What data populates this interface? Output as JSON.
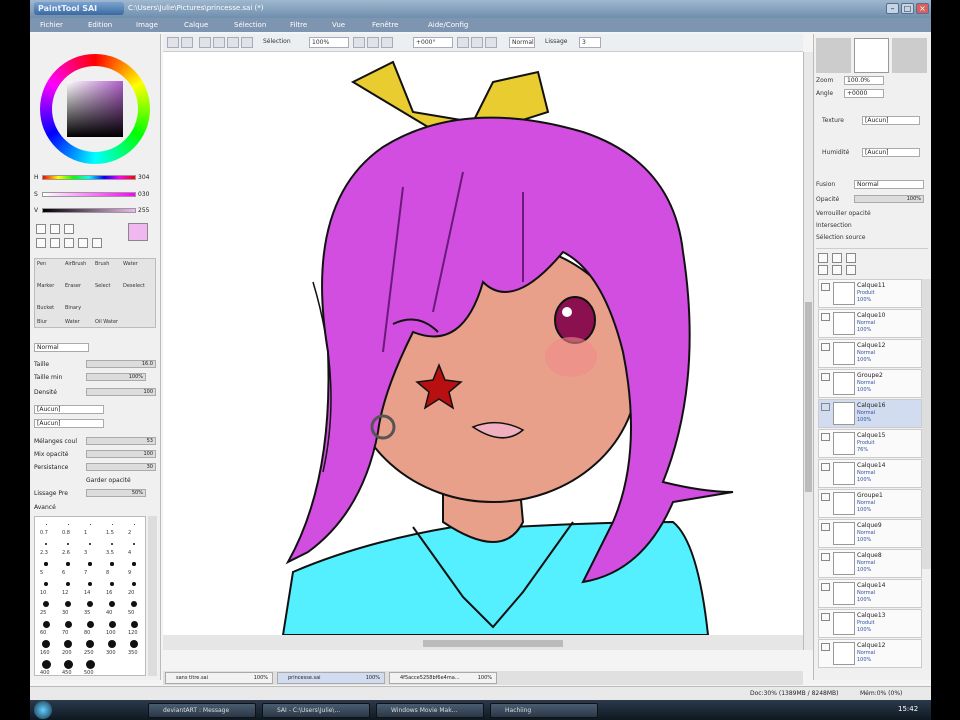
{
  "window": {
    "logo_text": "PaintTool SAI",
    "path": "C:\\Users\\Julie\\Pictures\\princesse.sai (*)",
    "min": "–",
    "max": "□",
    "close": "×"
  },
  "menu": [
    "Fichier",
    "Edition",
    "Image",
    "Calque",
    "Sélection",
    "Filtre",
    "Vue",
    "Fenêtre",
    "Aide/Config"
  ],
  "toolbar": {
    "selection_label": "Sélection",
    "zoom": "100%",
    "rotation": "+000°",
    "blend": "Normal",
    "stab_label": "Lissage",
    "stab_value": "3"
  },
  "color": {
    "h_label": "H",
    "h_value": "304",
    "s_label": "S",
    "s_value": "030",
    "v_label": "V",
    "v_value": "255",
    "current_color": "#f0b8f0"
  },
  "tools": {
    "labels": [
      "Pen",
      "AirBrush",
      "Brush",
      "Water",
      "Marker",
      "Eraser",
      "Select",
      "Deselect",
      "Bucket",
      "Binary",
      "Blur",
      "Water",
      "Oil Water"
    ]
  },
  "brush": {
    "mode": "Normal",
    "size_label": "Taille",
    "size_value": "16.0",
    "min_label": "Taille min",
    "min_value": "100%",
    "density_label": "Densité",
    "density_value": "100",
    "texture": "[Aucun]",
    "texture2": "[Aucun]",
    "blend_label": "Mélanges coul",
    "blend_value": "53",
    "dilution_label": "Mix opacité",
    "dilution_value": "100",
    "persist_label": "Persistance",
    "persist_value": "30",
    "keep_opacity": "Garder opacité",
    "pressure_label": "Lissage Pre",
    "pressure_value": "50%",
    "advanced": "Avancé"
  },
  "sizes": [
    "0.7",
    "0.8",
    "1",
    "1.5",
    "2",
    "2.3",
    "2.6",
    "3",
    "3.5",
    "4",
    "5",
    "6",
    "7",
    "8",
    "9",
    "10",
    "12",
    "14",
    "16",
    "20",
    "25",
    "30",
    "35",
    "40",
    "50",
    "60",
    "70",
    "80",
    "100",
    "120",
    "160",
    "200",
    "250",
    "300",
    "350",
    "400",
    "450",
    "500"
  ],
  "right": {
    "zoom_label": "Zoom",
    "zoom_value": "100.0%",
    "angle_label": "Angle",
    "angle_value": "+0000",
    "texture_label": "Texture",
    "texture_value": "[Aucun]",
    "effect_label": "Humidité",
    "effect_value": "[Aucun]",
    "fusion_label": "Fusion",
    "fusion_value": "Normal",
    "opacity_label": "Opacité",
    "opacity_value": "100%",
    "preserve": "Verrouiller opacité",
    "clip": "Intersection",
    "selection_source": "Sélection source"
  },
  "layers": [
    {
      "name": "Calque11",
      "mode": "Produit",
      "opacity": "100%"
    },
    {
      "name": "Calque10",
      "mode": "Normal",
      "opacity": "100%"
    },
    {
      "name": "Calque12",
      "mode": "Normal",
      "opacity": "100%"
    },
    {
      "name": "Groupe2",
      "mode": "Normal",
      "opacity": "100%"
    },
    {
      "name": "Calque16",
      "mode": "Normal",
      "opacity": "100%"
    },
    {
      "name": "Calque15",
      "mode": "Produit",
      "opacity": "76%"
    },
    {
      "name": "Calque14",
      "mode": "Normal",
      "opacity": "100%"
    },
    {
      "name": "Groupe1",
      "mode": "Normal",
      "opacity": "100%"
    },
    {
      "name": "Calque9",
      "mode": "Normal",
      "opacity": "100%"
    },
    {
      "name": "Calque8",
      "mode": "Normal",
      "opacity": "100%"
    },
    {
      "name": "Calque14",
      "mode": "Normal",
      "opacity": "100%"
    },
    {
      "name": "Calque13",
      "mode": "Produit",
      "opacity": "100%"
    },
    {
      "name": "Calque12",
      "mode": "Normal",
      "opacity": "100%"
    }
  ],
  "doctabs": [
    {
      "name": "sans titre.sai",
      "zoom": "100%"
    },
    {
      "name": "princesse.sai",
      "zoom": "100%"
    },
    {
      "name": "4f5acce5258bf6e4ma...",
      "zoom": "100%"
    }
  ],
  "status": {
    "memory": "Doc:30% (1389MB / 8248MB)",
    "extra": "Mém:0% (0%)"
  },
  "taskbar": {
    "items": [
      "deviantART : Message",
      "SAI - C:\\Users\\Julie\\...",
      "Windows Movie Mak...",
      "Hachiing"
    ],
    "clock": "15:42"
  }
}
